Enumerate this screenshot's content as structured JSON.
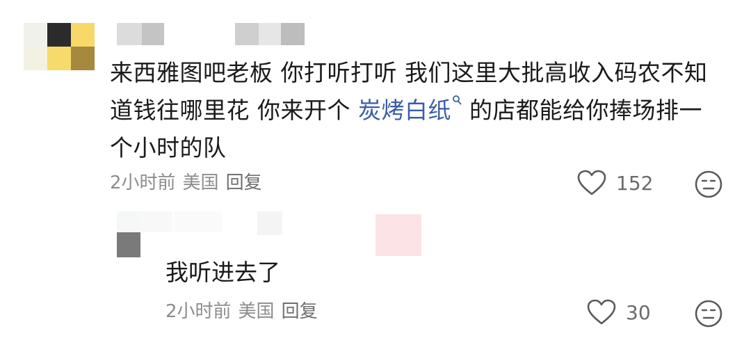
{
  "comment": {
    "text_before": "来西雅图吧老板 你打听打听 我们这里大批高收入码农不知道钱往哪里花 你来开个 ",
    "link_text": "炭烤白纸",
    "text_after": " 的店都能给你捧场排一个小时的队",
    "time": "2小时前",
    "location": "美国",
    "reply_label": "回复",
    "likes": "152"
  },
  "reply": {
    "text": "我听进去了",
    "time": "2小时前",
    "location": "美国",
    "reply_label": "回复",
    "likes": "30"
  },
  "icons": {
    "like": "heart-outline-icon",
    "dislike": "neutral-face-icon",
    "link": "search-icon"
  },
  "colors": {
    "link": "#3b5da8",
    "meta": "#8c8c8c"
  }
}
